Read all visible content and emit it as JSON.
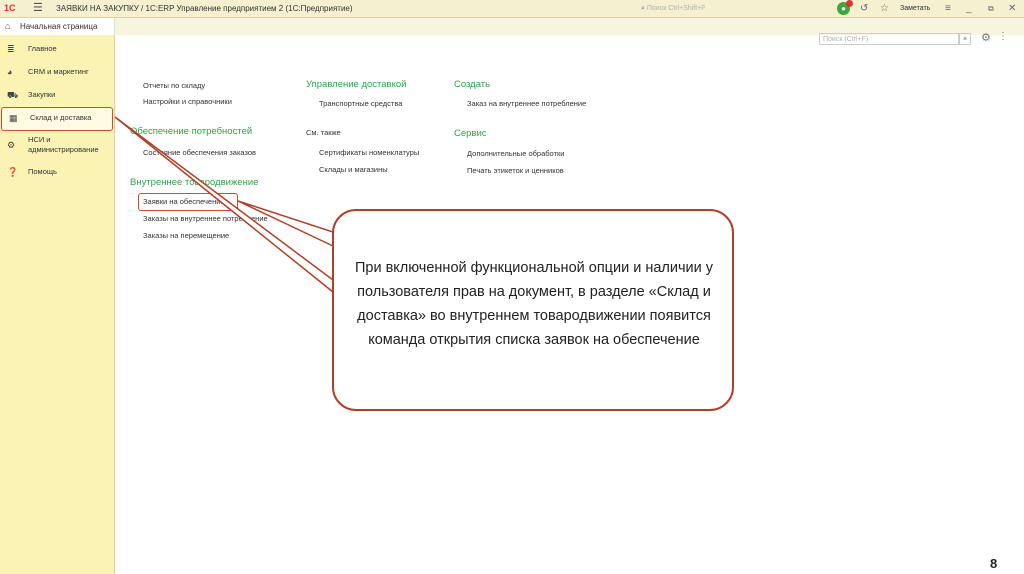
{
  "titlebar": {
    "logo": "1С",
    "title": "ЗАЯВКИ НА ЗАКУПКУ / 1С:ERP Управление предприятием 2  (1С:Предприятие)",
    "search_placeholder": "Поиск Ctrl+Shift+F",
    "user": "Заметать",
    "icons": [
      "menu-icon",
      "search-icon",
      "notification-icon",
      "history-icon",
      "star-icon",
      "settings-icon",
      "minimize-icon",
      "restore-icon",
      "close-icon"
    ]
  },
  "tabs": {
    "home": "Начальная страница"
  },
  "sidebar": {
    "items": [
      {
        "label": "Главное",
        "icon": "menu-icon"
      },
      {
        "label": "CRM и маркетинг",
        "icon": "pie-icon"
      },
      {
        "label": "Закупки",
        "icon": "cart-icon"
      },
      {
        "label": "Склад и доставка",
        "icon": "warehouse-icon",
        "active": true
      },
      {
        "label": "НСИ и администрирование",
        "icon": "gear-icon"
      },
      {
        "label": "Помощь",
        "icon": "help-icon"
      }
    ]
  },
  "main": {
    "search_placeholder": "Поиск (Ctrl+F)",
    "search_clear": "×",
    "col1": {
      "links_top": [
        "Отчеты по складу",
        "Настройки и справочники"
      ],
      "head_supply": "Обеспечение потребностей",
      "links_supply": [
        "Состояние обеспечения заказов"
      ],
      "head_internal": "Внутреннее товародвижение",
      "links_internal": [
        "Заявки на обеспечение",
        "Заказы на внутреннее потребление",
        "Заказы на перемещение"
      ]
    },
    "col2": {
      "head_delivery": "Управление доставкой",
      "links_delivery": [
        "Транспортные средства"
      ],
      "head_see_also": "См. также",
      "links_see_also": [
        "Сертификаты номенклатуры",
        "Склады и магазины"
      ]
    },
    "col3": {
      "head_create": "Создать",
      "links_create": [
        "Заказ на внутреннее потребление"
      ],
      "head_service": "Сервис",
      "links_service": [
        "Дополнительные обработки",
        "Печать этикеток и ценников"
      ]
    }
  },
  "callout": {
    "text": "При включенной функциональной опции и наличии у пользователя прав на документ, в разделе «Склад и доставка» во внутреннем товародвижении появится команда открытия списка заявок на обеспечение"
  },
  "page_number": "8",
  "colors": {
    "highlight": "#d24b2a",
    "green_head": "#2fa34a",
    "sidebar_bg": "#fbf3b3"
  }
}
